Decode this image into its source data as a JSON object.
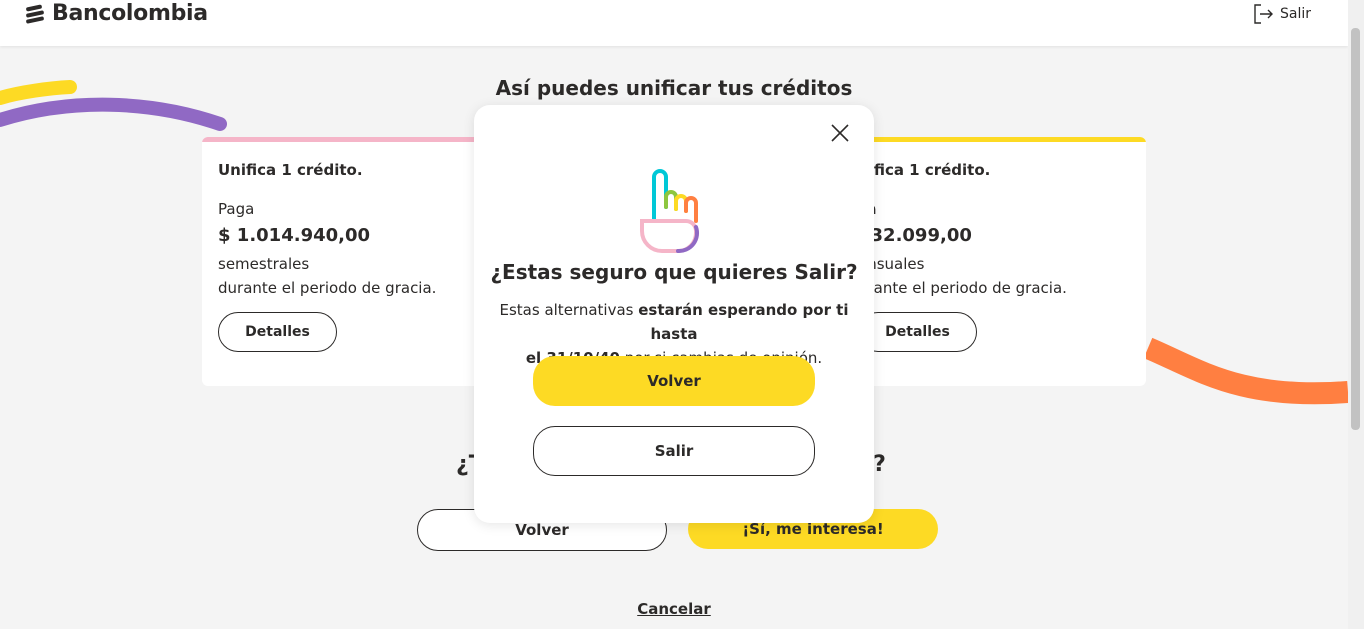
{
  "header": {
    "logo_text": "Bancolombia",
    "logout_label": "Salir"
  },
  "page": {
    "title": "Así puedes unificar tus créditos",
    "question_left": "¿T",
    "question_right": "s?",
    "cancel_label": "Cancelar"
  },
  "cards": [
    {
      "title": "Unifica 1 crédito.",
      "pay_label": "Paga",
      "amount": "$ 1.014.940,00",
      "frequency": "semestrales",
      "period": "durante el periodo de gracia.",
      "details_label": "Detalles",
      "accent": "#f5b5c8"
    },
    {
      "title": "nifica 1 crédito.",
      "pay_label": "ga",
      "amount": "232.099,00",
      "frequency": "ensuales",
      "period": "urante el periodo de gracia.",
      "details_label": "Detalles",
      "accent": "#fdda24"
    }
  ],
  "bottom_buttons": {
    "back_label": "Volver",
    "interest_label": "¡Sí, me interesa!"
  },
  "modal": {
    "title": "¿Estas seguro que quieres Salir?",
    "text_part1": "Estas alternativas ",
    "text_bold1": "estarán esperando por ti hasta",
    "text_bold2": "el 31/10/40",
    "text_part2": " por si cambias de opinión.",
    "primary_label": "Volver",
    "secondary_label": "Salir"
  },
  "colors": {
    "brand_yellow": "#fdda24",
    "purple": "#9069c4",
    "orange": "#ff7f41",
    "text": "#2c2a29"
  },
  "icons": [
    "bancolombia-logo-icon",
    "logout-icon",
    "close-icon",
    "hand-icon"
  ]
}
